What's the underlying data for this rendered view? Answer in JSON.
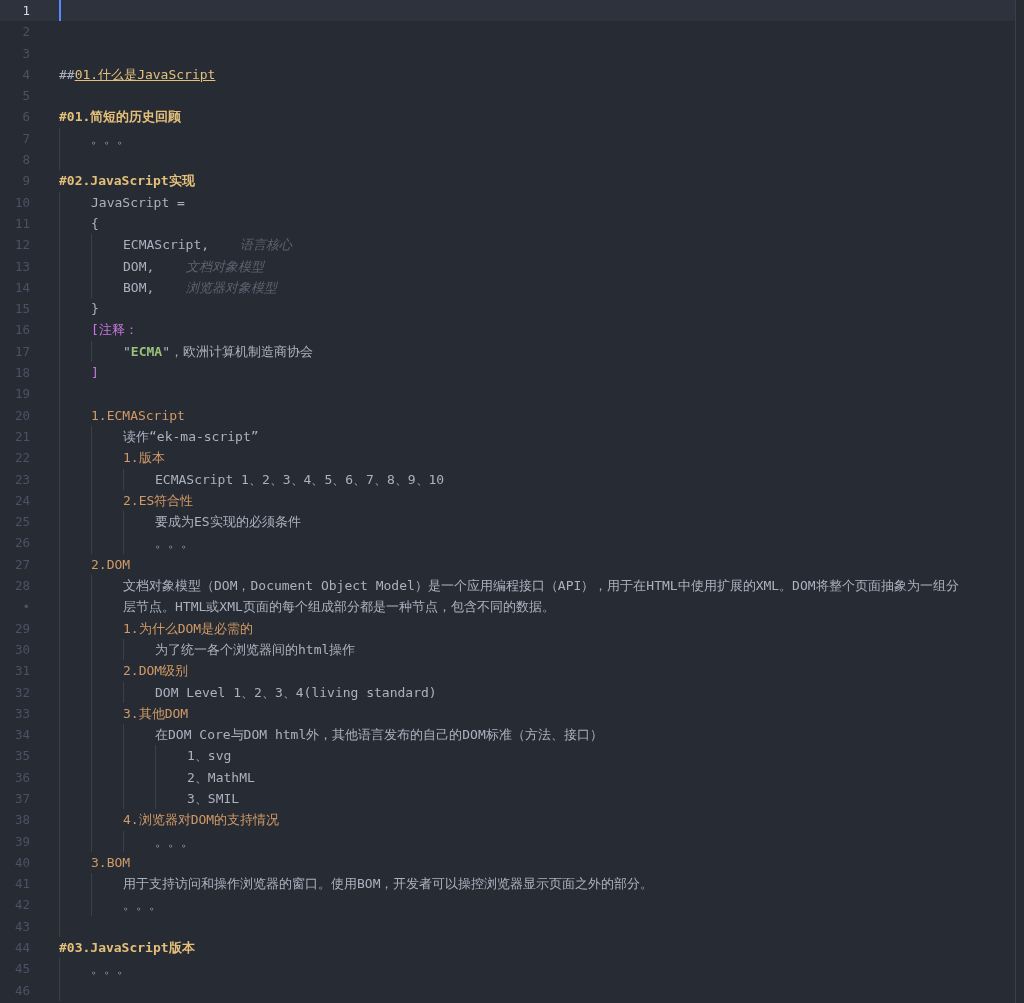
{
  "editor": {
    "lines": [
      {
        "number": "1",
        "current": true
      },
      {
        "number": "2",
        "current": false
      },
      {
        "number": "3",
        "current": false
      },
      {
        "number": "4",
        "current": false,
        "spans": [
          {
            "kind": "plain",
            "text": "##"
          },
          {
            "kind": "link",
            "text": "01.什么是JavaScript"
          }
        ]
      },
      {
        "number": "5",
        "current": false
      },
      {
        "number": "6",
        "current": false,
        "spans": [
          {
            "kind": "heading",
            "text": "#01.简短的历史回顾"
          }
        ],
        "children": [
          {
            "number": "7",
            "current": false,
            "spans": [
              {
                "kind": "plain",
                "text": "。。。"
              }
            ]
          },
          {
            "number": "8",
            "current": false
          }
        ]
      },
      {
        "number": "9",
        "current": false,
        "spans": [
          {
            "kind": "heading",
            "text": "#02.JavaScript实现"
          }
        ],
        "children": [
          {
            "number": "10",
            "current": false,
            "spans": [
              {
                "kind": "plain",
                "text": "JavaScript ="
              }
            ]
          },
          {
            "number": "11",
            "current": false,
            "spans": [
              {
                "kind": "plain",
                "text": "{"
              }
            ],
            "children": [
              {
                "number": "12",
                "current": false,
                "spans": [
                  {
                    "kind": "plain",
                    "text": "ECMAScript,"
                  },
                  {
                    "kind": "comment",
                    "text": "语言核心"
                  }
                ]
              },
              {
                "number": "13",
                "current": false,
                "spans": [
                  {
                    "kind": "plain",
                    "text": "DOM,"
                  },
                  {
                    "kind": "comment",
                    "text": "文档对象模型"
                  }
                ]
              },
              {
                "number": "14",
                "current": false,
                "spans": [
                  {
                    "kind": "plain",
                    "text": "BOM,"
                  },
                  {
                    "kind": "comment",
                    "text": "浏览器对象模型"
                  }
                ]
              }
            ]
          },
          {
            "number": "15",
            "current": false,
            "spans": [
              {
                "kind": "plain",
                "text": "}"
              }
            ]
          },
          {
            "number": "16",
            "current": false,
            "spans": [
              {
                "kind": "bracket",
                "text": "[注释："
              }
            ],
            "children": [
              {
                "number": "17",
                "current": false,
                "spans": [
                  {
                    "kind": "plain",
                    "text": "\""
                  },
                  {
                    "kind": "string",
                    "text": "ECMA"
                  },
                  {
                    "kind": "plain",
                    "text": "\"，欧洲计算机制造商协会"
                  }
                ]
              }
            ]
          },
          {
            "number": "18",
            "current": false,
            "spans": [
              {
                "kind": "bracket",
                "text": "]"
              }
            ]
          },
          {
            "number": "19",
            "current": false
          },
          {
            "number": "20",
            "current": false,
            "spans": [
              {
                "kind": "section",
                "text": "1.ECMAScript"
              }
            ],
            "children": [
              {
                "number": "21",
                "current": false,
                "spans": [
                  {
                    "kind": "plain",
                    "text": "读作“ek-ma-script”"
                  }
                ]
              },
              {
                "number": "22",
                "current": false,
                "spans": [
                  {
                    "kind": "section",
                    "text": "1.版本"
                  }
                ],
                "children": [
                  {
                    "number": "23",
                    "current": false,
                    "spans": [
                      {
                        "kind": "plain",
                        "text": "ECMAScript 1、2、3、4、5、6、7、8、9、10"
                      }
                    ]
                  }
                ]
              },
              {
                "number": "24",
                "current": false,
                "spans": [
                  {
                    "kind": "section",
                    "text": "2.ES符合性"
                  }
                ],
                "children": [
                  {
                    "number": "25",
                    "current": false,
                    "spans": [
                      {
                        "kind": "plain",
                        "text": "要成为ES实现的必须条件"
                      }
                    ]
                  },
                  {
                    "number": "26",
                    "current": false,
                    "spans": [
                      {
                        "kind": "plain",
                        "text": "。。。"
                      }
                    ]
                  }
                ]
              }
            ]
          },
          {
            "number": "27",
            "current": false,
            "spans": [
              {
                "kind": "section",
                "text": "2.DOM"
              }
            ],
            "children": [
              {
                "number": "28",
                "current": false,
                "spans": [
                  {
                    "kind": "plain",
                    "text": "文档对象模型（DOM，Document Object Model）是一个应用编程接口（API），用于在HTML中使用扩展的XML。DOM将整个页面抽象为一组分"
                  }
                ],
                "wrap_marker": "•",
                "wrap_text": "层节点。HTML或XML页面的每个组成部分都是一种节点，包含不同的数据。"
              },
              {
                "number": "29",
                "current": false,
                "spans": [
                  {
                    "kind": "section",
                    "text": "1.为什么DOM是必需的"
                  }
                ],
                "children": [
                  {
                    "number": "30",
                    "current": false,
                    "spans": [
                      {
                        "kind": "plain",
                        "text": "为了统一各个浏览器间的html操作"
                      }
                    ]
                  }
                ]
              },
              {
                "number": "31",
                "current": false,
                "spans": [
                  {
                    "kind": "section",
                    "text": "2.DOM级别"
                  }
                ],
                "children": [
                  {
                    "number": "32",
                    "current": false,
                    "spans": [
                      {
                        "kind": "plain",
                        "text": "DOM Level 1、2、3、4(living standard)"
                      }
                    ]
                  }
                ]
              },
              {
                "number": "33",
                "current": false,
                "spans": [
                  {
                    "kind": "section",
                    "text": "3.其他DOM"
                  }
                ],
                "children": [
                  {
                    "number": "34",
                    "current": false,
                    "spans": [
                      {
                        "kind": "plain",
                        "text": "在DOM Core与DOM html外，其他语言发布的自己的DOM标准（方法、接口）"
                      }
                    ],
                    "children": [
                      {
                        "number": "35",
                        "current": false,
                        "spans": [
                          {
                            "kind": "plain",
                            "text": "1、svg"
                          }
                        ]
                      },
                      {
                        "number": "36",
                        "current": false,
                        "spans": [
                          {
                            "kind": "plain",
                            "text": "2、MathML"
                          }
                        ]
                      },
                      {
                        "number": "37",
                        "current": false,
                        "spans": [
                          {
                            "kind": "plain",
                            "text": "3、SMIL"
                          }
                        ]
                      }
                    ]
                  }
                ]
              },
              {
                "number": "38",
                "current": false,
                "spans": [
                  {
                    "kind": "section",
                    "text": "4.浏览器对DOM的支持情况"
                  }
                ],
                "children": [
                  {
                    "number": "39",
                    "current": false,
                    "spans": [
                      {
                        "kind": "plain",
                        "text": "。。。"
                      }
                    ]
                  }
                ]
              }
            ]
          },
          {
            "number": "40",
            "current": false,
            "spans": [
              {
                "kind": "section",
                "text": "3.BOM"
              }
            ],
            "children": [
              {
                "number": "41",
                "current": false,
                "spans": [
                  {
                    "kind": "plain",
                    "text": "用于支持访问和操作浏览器的窗口。使用BOM，开发者可以操控浏览器显示页面之外的部分。"
                  }
                ]
              },
              {
                "number": "42",
                "current": false,
                "spans": [
                  {
                    "kind": "plain",
                    "text": "。。。"
                  }
                ]
              }
            ]
          },
          {
            "number": "43",
            "current": false
          }
        ]
      },
      {
        "number": "44",
        "current": false,
        "spans": [
          {
            "kind": "heading",
            "text": "#03.JavaScript版本"
          }
        ],
        "children": [
          {
            "number": "45",
            "current": false,
            "spans": [
              {
                "kind": "plain",
                "text": "。。。"
              }
            ]
          },
          {
            "number": "46",
            "current": false
          }
        ]
      }
    ]
  }
}
